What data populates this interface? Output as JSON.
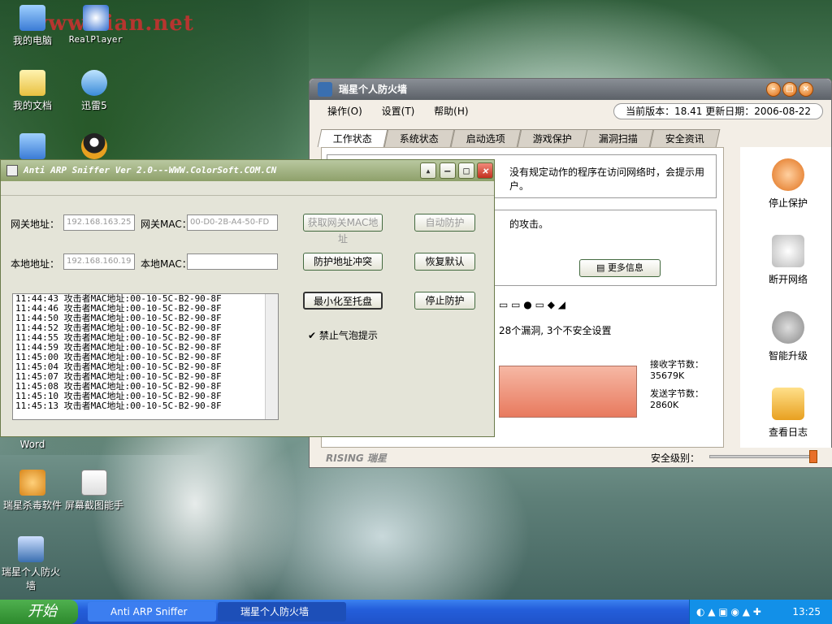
{
  "watermark": "www.vian.net",
  "desktop": {
    "icons": [
      "我的电脑",
      "RealPlayer",
      "我的文档",
      "迅雷5",
      "瑞星杀毒软件",
      "屏幕截图能手",
      "瑞星个人防火墙"
    ],
    "partial": [
      "Word"
    ]
  },
  "rising": {
    "title": "瑞星个人防火墙",
    "menu": [
      "操作(O)",
      "设置(T)",
      "帮助(H)"
    ],
    "version": "当前版本：18.41  更新日期：2006-08-22",
    "tabs": [
      "工作状态",
      "系统状态",
      "启动选项",
      "游戏保护",
      "漏洞扫描",
      "安全资讯"
    ],
    "panel_text1": "没有规定动作的程序在访问网络时，会提示用户。",
    "panel_text2": "的攻击。",
    "more_info": "更多信息",
    "vuln": "28个漏洞, 3个不安全设置",
    "recv_label": "接收字节数：",
    "recv_val": "35679K",
    "send_label": "发送字节数：",
    "send_val": "2860K",
    "side": [
      "停止保护",
      "断开网络",
      "智能升级",
      "查看日志"
    ],
    "security_level": "安全级别：",
    "brand": "RISING 瑞星",
    "colors": {
      "accent": "#e8702a",
      "progress": "#f08a70"
    }
  },
  "arp": {
    "title": "Anti ARP Sniffer Ver 2.0---WWW.ColorSoft.COM.CN",
    "gw_label": "网关地址：",
    "gw_value": "192.168.163.25",
    "gwmac_label": "网关MAC：",
    "gwmac_value": "00-D0-2B-A4-50-FD",
    "get_mac": "获取网关MAC地址",
    "auto_protect": "自动防护",
    "local_label": "本地地址：",
    "local_value": "192.168.160.19",
    "localmac_label": "本地MAC：",
    "localmac_value": "",
    "protect_conflict": "防护地址冲突",
    "restore_default": "恢复默认",
    "minimize_tray": "最小化至托盘",
    "stop_protect": "停止防护",
    "bubble": "禁止气泡提示",
    "log": [
      "11:44:43 攻击者MAC地址:00-10-5C-B2-90-8F",
      "11:44:46 攻击者MAC地址:00-10-5C-B2-90-8F",
      "11:44:50 攻击者MAC地址:00-10-5C-B2-90-8F",
      "11:44:52 攻击者MAC地址:00-10-5C-B2-90-8F",
      "11:44:55 攻击者MAC地址:00-10-5C-B2-90-8F",
      "11:44:59 攻击者MAC地址:00-10-5C-B2-90-8F",
      "11:45:00 攻击者MAC地址:00-10-5C-B2-90-8F",
      "11:45:04 攻击者MAC地址:00-10-5C-B2-90-8F",
      "11:45:07 攻击者MAC地址:00-10-5C-B2-90-8F",
      "11:45:08 攻击者MAC地址:00-10-5C-B2-90-8F",
      "11:45:10 攻击者MAC地址:00-10-5C-B2-90-8F",
      "11:45:13 攻击者MAC地址:00-10-5C-B2-90-8F"
    ]
  },
  "taskbar": {
    "start": "开始",
    "tasks": [
      "Anti ARP Sniffer",
      "瑞星个人防火墙"
    ],
    "clock": "13:25"
  }
}
